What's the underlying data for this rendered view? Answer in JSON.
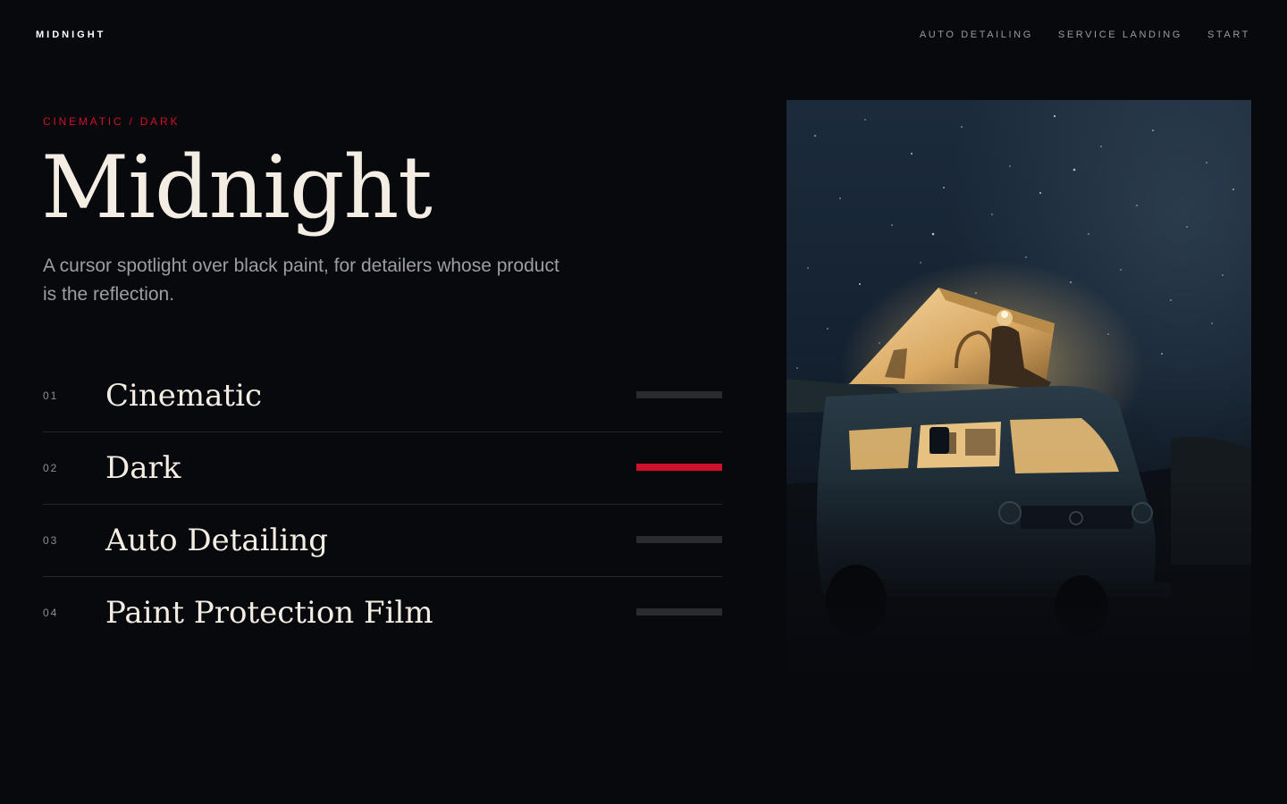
{
  "header": {
    "brand": "MIDNIGHT",
    "nav": [
      {
        "label": "AUTO DETAILING"
      },
      {
        "label": "SERVICE LANDING"
      },
      {
        "label": "START"
      }
    ]
  },
  "hero": {
    "eyebrow": "CINEMATIC / DARK",
    "title": "Midnight",
    "lede": "A cursor spotlight over black paint, for detailers whose product is the reflection."
  },
  "services": [
    {
      "num": "01",
      "title": "Cinematic",
      "active": false
    },
    {
      "num": "02",
      "title": "Dark",
      "active": true
    },
    {
      "num": "03",
      "title": "Auto Detailing",
      "active": false
    },
    {
      "num": "04",
      "title": "Paint Protection Film",
      "active": false
    }
  ],
  "colors": {
    "background": "#08090d",
    "accent": "#d0112b",
    "text": "#f4ede4",
    "muted": "#9d9da3"
  }
}
